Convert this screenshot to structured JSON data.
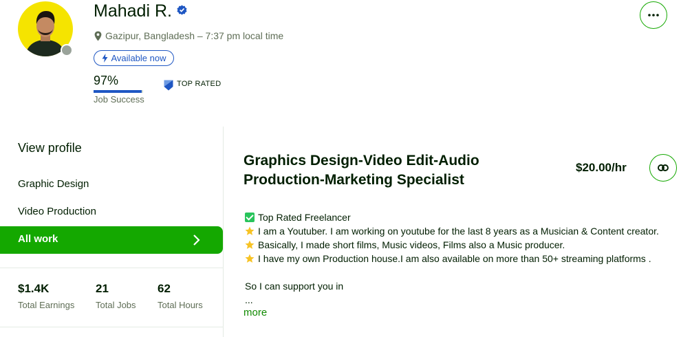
{
  "profile": {
    "name": "Mahadi R.",
    "location": "Gazipur, Bangladesh – 7:37 pm local time",
    "availability": "Available now",
    "job_success": {
      "value_text": "97%",
      "fraction": 0.97,
      "label": "Job Success"
    },
    "badge": "TOP RATED"
  },
  "sidebar": {
    "view_profile": "View profile",
    "items": [
      {
        "label": "Graphic Design"
      },
      {
        "label": "Video Production"
      },
      {
        "label": "All work"
      }
    ],
    "stats": [
      {
        "value": "$1.4K",
        "label": "Total Earnings"
      },
      {
        "value": "21",
        "label": "Total Jobs"
      },
      {
        "value": "62",
        "label": "Total Hours"
      }
    ]
  },
  "main": {
    "title_line1": "Graphics Design-Video Edit-Audio",
    "title_line2": "Production-Marketing Specialist",
    "rate": "$20.00/hr",
    "description": [
      "Top Rated Freelancer",
      "I am a Youtuber. I am working on youtube for the last 8 years as a Musician & Content creator.",
      "Basically, I made short films, Music videos, Films also a Music producer.",
      "I have my own Production house.I am also available on more than 50+ streaming platforms .",
      "",
      "So I can support you in",
      "..."
    ],
    "more_link": "more"
  },
  "icons": {
    "more": "ellipsis-icon",
    "link": "link-icon",
    "location": "map-pin-icon",
    "verified": "verified-badge-icon",
    "availability": "lightning-bolt-icon",
    "top_rated": "top-rated-badge-icon",
    "chevron": "chevron-right-icon"
  },
  "colors": {
    "brand_green": "#14a800",
    "link_green": "#108a00",
    "accent_blue": "#1f57c3",
    "text_dark": "#001e00",
    "text_muted": "#5e6d55",
    "avatar_bg": "#f5e400"
  }
}
